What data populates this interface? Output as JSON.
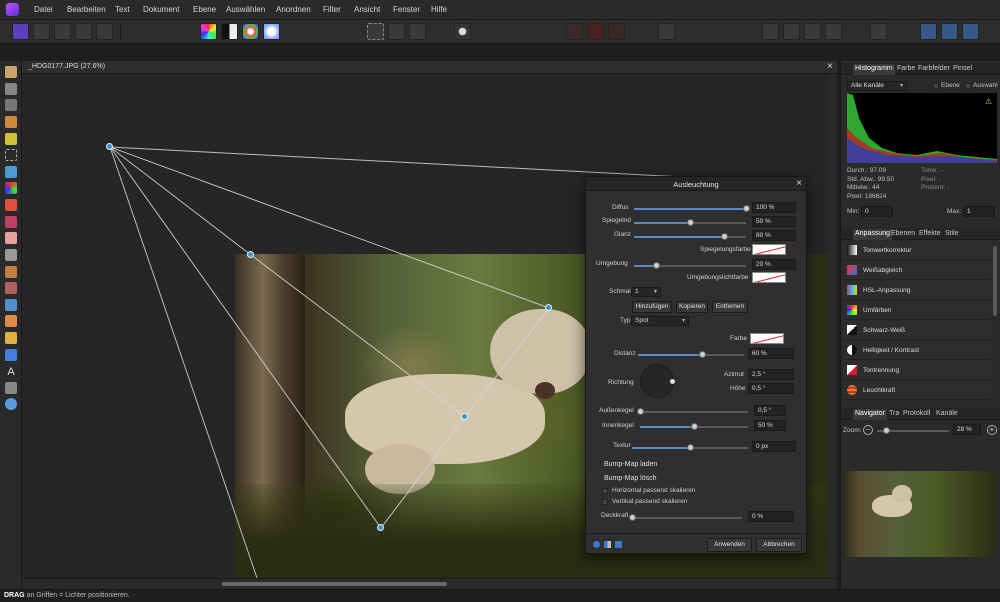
{
  "menu": [
    "Datei",
    "Bearbeiten",
    "Text",
    "Dokument",
    "Ebene",
    "Auswählen",
    "Anordnen",
    "Filter",
    "Ansicht",
    "Fenster",
    "Hilfe"
  ],
  "document": {
    "tab_title": "_HDG0177.JPG (27.6%)",
    "close": "×"
  },
  "status": {
    "bold": "DRAG",
    "text": " an Griffen = Lichter positionieren."
  },
  "histogram": {
    "tabs": [
      "Histogramm",
      "Farbe",
      "Farbfelder",
      "Pinsel"
    ],
    "channel": "Alle Kanäle",
    "check_layer": "Ebene",
    "check_selection": "Auswahl",
    "warning_icon": "warning-icon",
    "stats_left": [
      [
        "Durch.:",
        "97.09"
      ],
      [
        "Std. Abw.:",
        "99.50"
      ],
      [
        "Mittelw.:",
        "44"
      ],
      [
        "Pixel:",
        "186624"
      ]
    ],
    "stats_right": [
      "Tonw.: -",
      "Pixel: -",
      "Prozent: -"
    ],
    "min_label": "Min:",
    "min_value": "0",
    "max_label": "Max:",
    "max_value": "1"
  },
  "adjustment": {
    "tabs": [
      "Anpassung",
      "Ebenen",
      "Effekte",
      "Stile"
    ],
    "items": [
      "Tonwertkorrektur",
      "Weißabgleich",
      "HSL-Anpassung",
      "Umfärben",
      "Schwarz-Weiß",
      "Helligkeit / Kontrast",
      "Tontrennung",
      "Leuchtkraft"
    ],
    "colors": [
      "#ffffff",
      "#3a6fd8",
      "#c03a8a",
      "#e0a020",
      "#ffffff",
      "#ffffff",
      "#d02030",
      "#e08020"
    ]
  },
  "navigator": {
    "tabs": [
      "Navigator",
      "Tra",
      "Protokoll",
      "Kanäle"
    ],
    "zoom_label": "Zoom:",
    "zoom_value": "28 %"
  },
  "dialog": {
    "title": "Ausleuchtung",
    "close": "×",
    "diffus_label": "Diffus",
    "diffus_value": "100 %",
    "diffus": 1.0,
    "spiegelnd_label": "Spiegelnd",
    "spiegelnd_value": "50 %",
    "spiegelnd": 0.5,
    "glanz_label": "Glanz",
    "glanz_value": "80 %",
    "glanz": 0.8,
    "spiegelungsfarbe_label": "Spiegelungsfarbe",
    "umgebung_label": "Umgebung",
    "umgebung_value": "20 %",
    "umgebung": 0.2,
    "umgebungslichtfarbe_label": "Umgebungslichtfarbe",
    "light_label": "Schmal",
    "light_value": "1",
    "add_button": "Hinzufügen",
    "copy_button": "Kopieren",
    "remove_button": "Entfernen",
    "type_label": "Typ",
    "type_value": "Spot",
    "farbe_label": "Farbe",
    "distanz_label": "Distanz",
    "distanz_value": "60 %",
    "distanz": 0.6,
    "richtung_label": "Richtung",
    "azimut_label": "Azimut",
    "azimut_value": "2,5 °",
    "hoehe_label": "Höhe",
    "hoehe_value": "0,5 °",
    "aussenkegel_label": "Außenkegel",
    "aussenkegel_value": "0,5 °",
    "aussenkegel": 0.0,
    "innenkegel_label": "Innenkegel",
    "innenkegel_value": "50 %",
    "innenkegel": 0.5,
    "textur_label": "Textur",
    "textur_value": "0 px",
    "textur": 0.5,
    "bump_load": "Bump-Map laden",
    "bump_delete": "Bump-Map lösch",
    "horiz_label": "Horizontal passend skalieren",
    "vert_label": "Vertikal passend skalieren",
    "deckkraft_label": "Deckkraft",
    "deckkraft_value": "0 %",
    "deckkraft": 0.0,
    "apply_button": "Anwenden",
    "cancel_button": "Abbrechen"
  }
}
